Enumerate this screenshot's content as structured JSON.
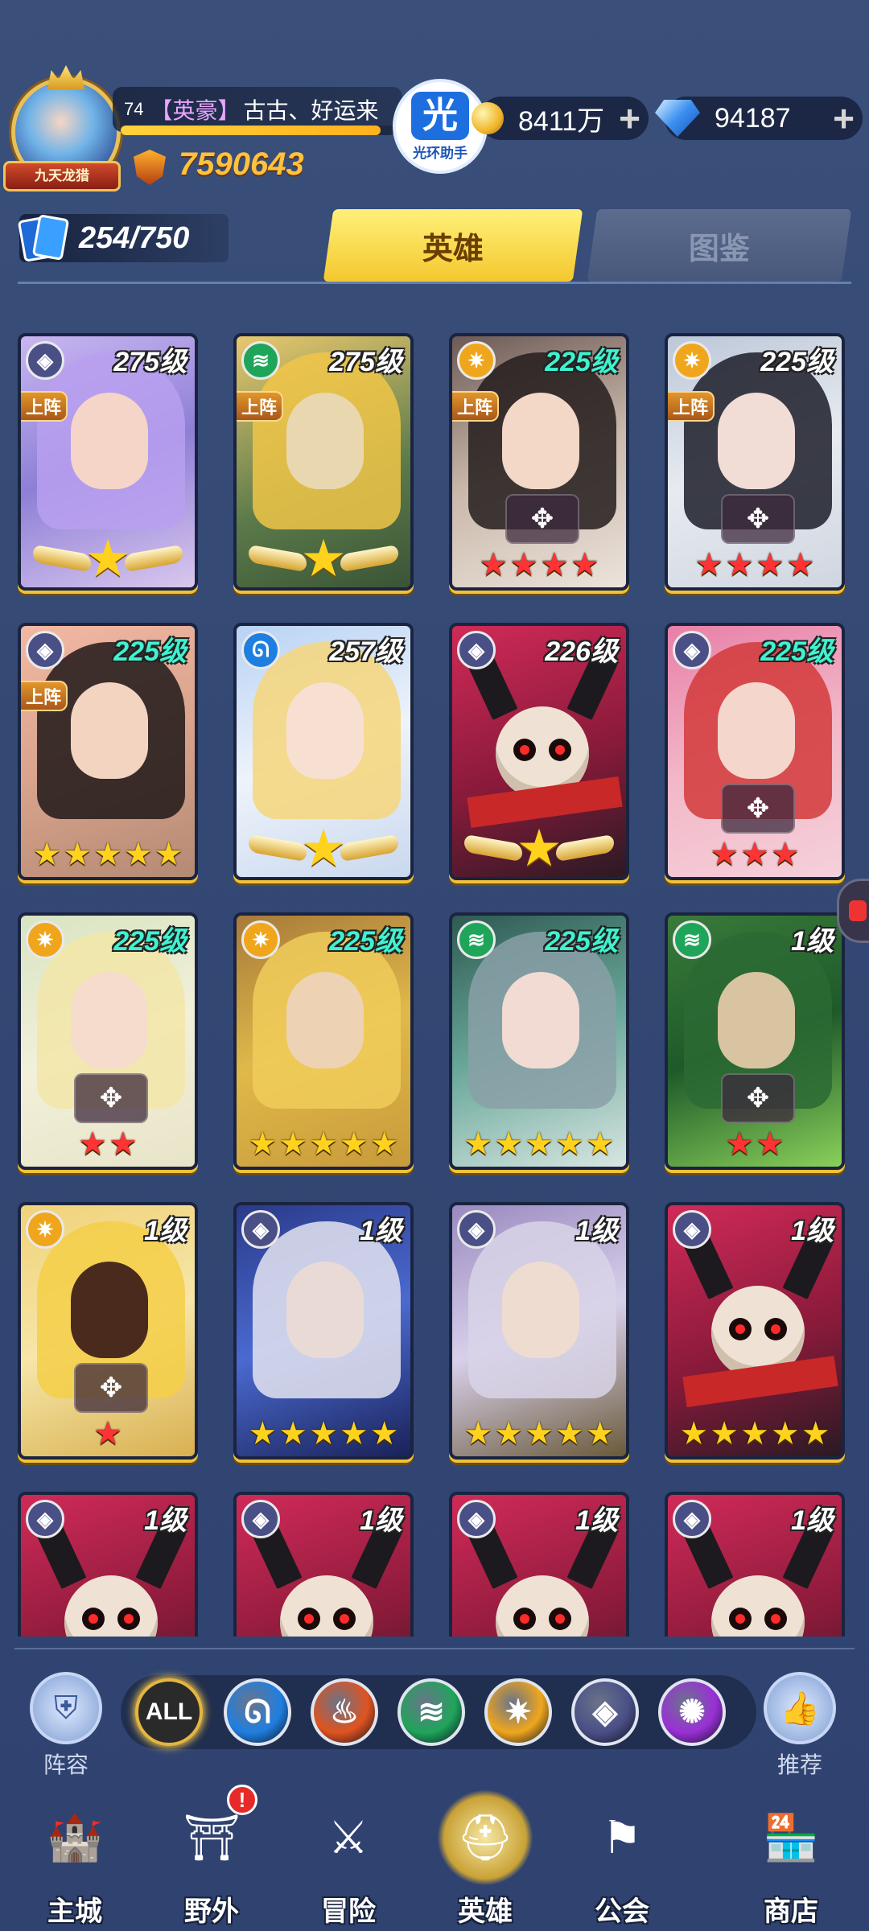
{
  "player": {
    "level": "74",
    "guild_tag": "【英豪】",
    "name": "古古、好运来",
    "exp_fraction": 0.95,
    "power": "7590643",
    "avatar_badge": "九天龙猎"
  },
  "helper": {
    "glyph": "光",
    "label": "光环助手"
  },
  "resources": {
    "gold": "8411万",
    "gems": "94187",
    "plus_symbol": "+"
  },
  "hero_count": "254/750",
  "tabs": [
    {
      "label": "英雄",
      "active": true
    },
    {
      "label": "图鉴",
      "active": false
    }
  ],
  "deploy_label": "上阵",
  "heroes": [
    {
      "level": "275级",
      "level_color": "white",
      "element": "shadow",
      "deployed": true,
      "stars": "wing1",
      "art": "purple-hair"
    },
    {
      "level": "275级",
      "level_color": "white",
      "element": "wind",
      "deployed": true,
      "stars": "wing1",
      "art": "blonde-hood"
    },
    {
      "level": "225级",
      "level_color": "cyan",
      "element": "light",
      "deployed": true,
      "stars": "red4",
      "art": "dark-hair"
    },
    {
      "level": "225级",
      "level_color": "white",
      "element": "light",
      "deployed": true,
      "stars": "red4",
      "art": "black-hair-elf"
    },
    {
      "level": "225级",
      "level_color": "cyan",
      "element": "shadow",
      "deployed": true,
      "stars": "gold5",
      "art": "black-bun"
    },
    {
      "level": "257级",
      "level_color": "white",
      "element": "water",
      "deployed": false,
      "stars": "wing1",
      "art": "blonde-veil"
    },
    {
      "level": "226级",
      "level_color": "white",
      "element": "shadow",
      "deployed": false,
      "stars": "wing1",
      "art": "skull"
    },
    {
      "level": "225级",
      "level_color": "cyan",
      "element": "shadow",
      "deployed": false,
      "stars": "red3",
      "art": "red-hair"
    },
    {
      "level": "225级",
      "level_color": "cyan",
      "element": "light",
      "deployed": false,
      "stars": "red2",
      "art": "platinum"
    },
    {
      "level": "225级",
      "level_color": "cyan",
      "element": "light",
      "deployed": false,
      "stars": "gold5",
      "art": "goggles"
    },
    {
      "level": "225级",
      "level_color": "cyan",
      "element": "wind",
      "deployed": false,
      "stars": "gold5",
      "art": "elf-silver"
    },
    {
      "level": "1级",
      "level_color": "white",
      "element": "wind",
      "deployed": false,
      "stars": "red2",
      "art": "green-hood"
    },
    {
      "level": "1级",
      "level_color": "white",
      "element": "light",
      "deployed": false,
      "stars": "red1",
      "art": "gold-priestess"
    },
    {
      "level": "1级",
      "level_color": "white",
      "element": "shadow",
      "deployed": false,
      "stars": "gold5",
      "art": "white-hair-mage"
    },
    {
      "level": "1级",
      "level_color": "white",
      "element": "shadow",
      "deployed": false,
      "stars": "gold5",
      "art": "glasses"
    },
    {
      "level": "1级",
      "level_color": "white",
      "element": "shadow",
      "deployed": false,
      "stars": "gold5",
      "art": "skull"
    },
    {
      "level": "1级",
      "level_color": "white",
      "element": "shadow",
      "deployed": false,
      "stars": "none",
      "art": "skull"
    },
    {
      "level": "1级",
      "level_color": "white",
      "element": "shadow",
      "deployed": false,
      "stars": "none",
      "art": "skull"
    },
    {
      "level": "1级",
      "level_color": "white",
      "element": "shadow",
      "deployed": false,
      "stars": "none",
      "art": "skull"
    },
    {
      "level": "1级",
      "level_color": "white",
      "element": "shadow",
      "deployed": false,
      "stars": "none",
      "art": "skull"
    }
  ],
  "filters": {
    "lineup_label": "阵容",
    "recommend_label": "推荐",
    "all_label": "ALL",
    "elements": [
      "water",
      "fire",
      "wind",
      "light",
      "shadow",
      "arcane"
    ]
  },
  "nav": [
    {
      "label": "主城",
      "icon": "castle-icon",
      "active": false,
      "badge": ""
    },
    {
      "label": "野外",
      "icon": "portal-icon",
      "active": false,
      "badge": "!"
    },
    {
      "label": "冒险",
      "icon": "sword-icon",
      "active": false,
      "badge": ""
    },
    {
      "label": "英雄",
      "icon": "helmet-icon",
      "active": true,
      "badge": ""
    },
    {
      "label": "公会",
      "icon": "banner-icon",
      "active": false,
      "badge": ""
    },
    {
      "label": "商店",
      "icon": "shop-icon",
      "active": false,
      "badge": ""
    }
  ],
  "colors": {
    "water": "#1f7fe0",
    "fire": "#e0531f",
    "wind": "#1fa55a",
    "light": "#f0a61c",
    "shadow": "#4a4f86",
    "arcane": "#9a2fd6",
    "accent": "#f4c82e"
  }
}
